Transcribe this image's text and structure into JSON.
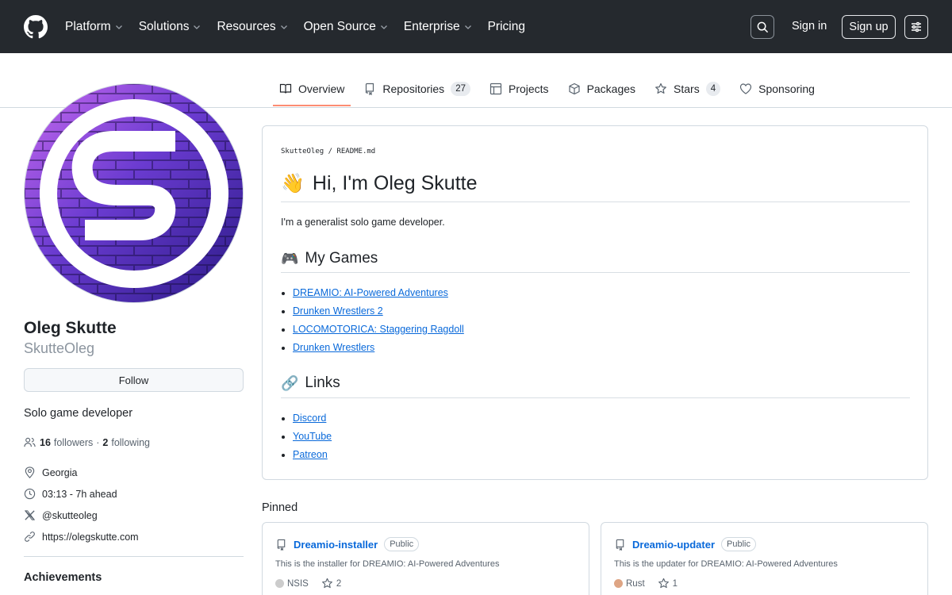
{
  "header": {
    "nav": [
      {
        "label": "Platform",
        "dropdown": true
      },
      {
        "label": "Solutions",
        "dropdown": true
      },
      {
        "label": "Resources",
        "dropdown": true
      },
      {
        "label": "Open Source",
        "dropdown": true
      },
      {
        "label": "Enterprise",
        "dropdown": true
      },
      {
        "label": "Pricing",
        "dropdown": false
      }
    ],
    "sign_in": "Sign in",
    "sign_up": "Sign up"
  },
  "tabs": [
    {
      "label": "Overview",
      "icon": "book-icon",
      "counter": null,
      "active": true
    },
    {
      "label": "Repositories",
      "icon": "repo-icon",
      "counter": "27",
      "active": false
    },
    {
      "label": "Projects",
      "icon": "table-icon",
      "counter": null,
      "active": false
    },
    {
      "label": "Packages",
      "icon": "package-icon",
      "counter": null,
      "active": false
    },
    {
      "label": "Stars",
      "icon": "star-icon",
      "counter": "4",
      "active": false
    },
    {
      "label": "Sponsoring",
      "icon": "heart-icon",
      "counter": null,
      "active": false
    }
  ],
  "profile": {
    "name": "Oleg Skutte",
    "login": "SkutteOleg",
    "follow_label": "Follow",
    "bio": "Solo game developer",
    "followers_count": "16",
    "followers_label": "followers",
    "separator": "·",
    "following_count": "2",
    "following_label": "following",
    "location": "Georgia",
    "local_time": "03:13 - 7h ahead",
    "x_handle": "@skutteoleg",
    "website": "https://olegskutte.com",
    "achievements_label": "Achievements"
  },
  "readme": {
    "breadcrumb_user": "SkutteOleg",
    "breadcrumb_sep": "/",
    "breadcrumb_file": "README.md",
    "h1_emoji": "👋",
    "h1": "Hi, I'm Oleg Skutte",
    "intro": "I'm a generalist solo game developer.",
    "games_emoji": "🎮",
    "games_heading": "My Games",
    "games": [
      "DREAMIO: AI-Powered Adventures",
      "Drunken Wrestlers 2",
      "LOCOMOTORICA: Staggering Ragdoll",
      "Drunken Wrestlers"
    ],
    "links_emoji": "🔗",
    "links_heading": "Links",
    "links": [
      "Discord",
      "YouTube",
      "Patreon"
    ]
  },
  "pinned": {
    "title": "Pinned",
    "repos": [
      {
        "name": "Dreamio-installer",
        "visibility": "Public",
        "description": "This is the installer for DREAMIO: AI-Powered Adventures",
        "language": "NSIS",
        "language_color": "#cccccc",
        "stars": "2"
      },
      {
        "name": "Dreamio-updater",
        "visibility": "Public",
        "description": "This is the updater for DREAMIO: AI-Powered Adventures",
        "language": "Rust",
        "language_color": "#dea584",
        "stars": "1"
      }
    ]
  }
}
